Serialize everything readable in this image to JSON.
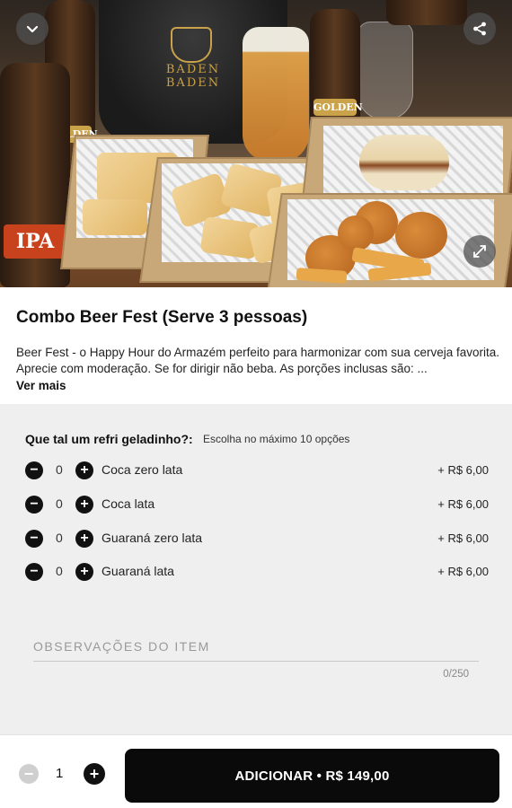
{
  "hero": {
    "bucket_label": "BADEN BADEN",
    "bottle_labels": [
      "GOLDEN",
      "IPA",
      "GOLDEN"
    ],
    "icons": {
      "back": "chevron-down-icon",
      "share": "share-icon",
      "expand": "expand-icon"
    }
  },
  "product": {
    "title": "Combo Beer Fest (Serve 3 pessoas)",
    "description": "Beer Fest - o Happy Hour do Armazém perfeito para harmonizar com sua cerveja favorita. Aprecie com moderação. Se for dirigir não beba. As porções inclusas são: ...",
    "more_label": "Ver mais"
  },
  "options": {
    "heading": "Que tal um refri geladinho?:",
    "subheading": "Escolha no máximo 10 opções",
    "items": [
      {
        "name": "Coca zero lata",
        "qty": "0",
        "price": "+ R$ 6,00"
      },
      {
        "name": "Coca lata",
        "qty": "0",
        "price": "+ R$ 6,00"
      },
      {
        "name": "Guaraná zero lata",
        "qty": "0",
        "price": "+ R$ 6,00"
      },
      {
        "name": "Guaraná lata",
        "qty": "0",
        "price": "+ R$ 6,00"
      }
    ]
  },
  "notes": {
    "placeholder": "OBSERVAÇÕES DO ITEM",
    "counter": "0/250"
  },
  "footer": {
    "quantity": "1",
    "add_label": "ADICIONAR • R$ 149,00"
  },
  "colors": {
    "primary": "#0a0a0a",
    "panel": "#efefef",
    "disabled": "#cfcfcf"
  }
}
